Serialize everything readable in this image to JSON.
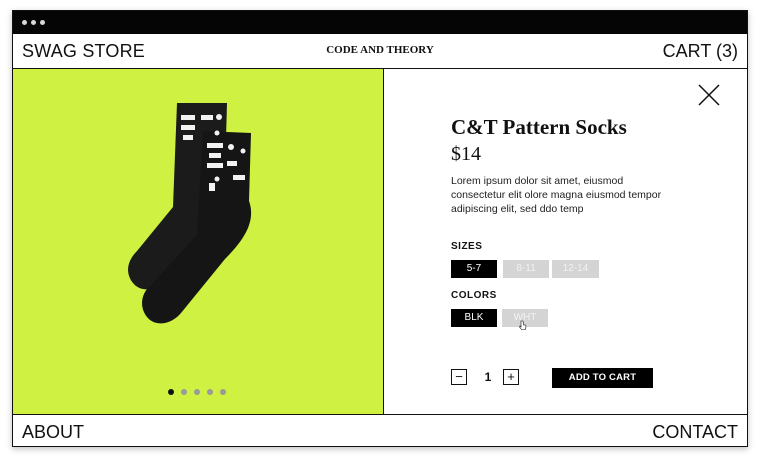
{
  "nav": {
    "store_name": "SWAG STORE",
    "brand": "CODE AND THEORY",
    "cart_label": "CART (3)"
  },
  "hero": {
    "image": "black-pattern-socks-photo",
    "background_color": "#cef142",
    "carousel_count": 5,
    "carousel_active_index": 0
  },
  "product": {
    "title": "C&T Pattern Socks",
    "price": "$14",
    "description": "Lorem ipsum dolor sit amet, eiusmod consectetur elit olore magna eiusmod tempor adipiscing elit, sed ddo temp",
    "sizes_label": "SIZES",
    "sizes": [
      {
        "label": "5-7",
        "selected": true,
        "available": true
      },
      {
        "label": "8-11",
        "selected": false,
        "available": false
      },
      {
        "label": "12-14",
        "selected": false,
        "available": false
      }
    ],
    "colors_label": "COLORS",
    "colors": [
      {
        "label": "BLK",
        "selected": true,
        "available": true
      },
      {
        "label": "WHT",
        "selected": false,
        "available": false
      }
    ],
    "quantity_minus": "−",
    "quantity": "1",
    "quantity_plus": "+",
    "add_to_cart": "ADD TO CART"
  },
  "footer": {
    "about": "ABOUT",
    "contact": "CONTACT"
  },
  "icons": {
    "close": "close-icon",
    "cursor": "pointer-cursor-icon"
  }
}
